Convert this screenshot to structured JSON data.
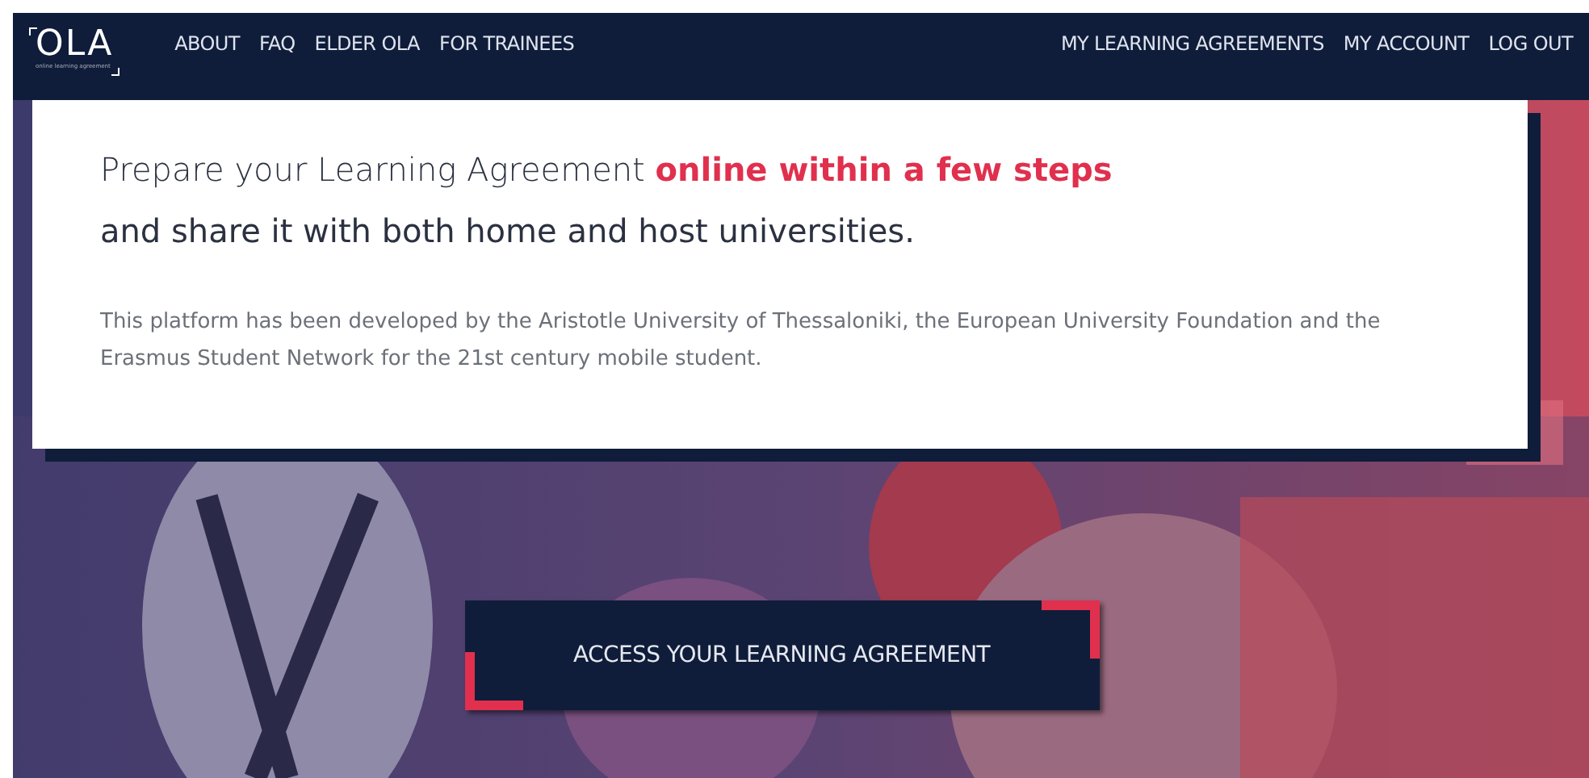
{
  "logo": {
    "text": "OLA",
    "tagline": "online learning agreement"
  },
  "nav_left": [
    "ABOUT",
    "FAQ",
    "ELDER OLA",
    "FOR TRAINEES"
  ],
  "nav_right": [
    "MY LEARNING AGREEMENTS",
    "MY ACCOUNT",
    "LOG OUT"
  ],
  "intro": {
    "headline": "Prepare your Learning Agreement **online within a few steps**",
    "subline": "and share it with both home and host universities.",
    "description": "This platform has been developed by the Aristotle University of Thessaloniki, the European University Foundation and the Erasmus Student Network for the 21st century mobile student."
  },
  "hero": {
    "kind": "picture"
  },
  "cta_button": "ACCESS YOUR LEARNING AGREEMENT"
}
